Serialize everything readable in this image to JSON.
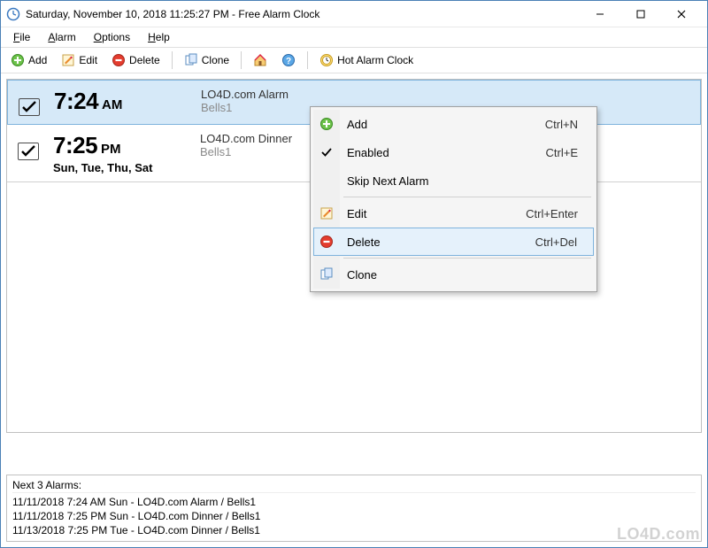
{
  "title": "Saturday, November 10, 2018 11:25:27 PM - Free Alarm Clock",
  "menu": {
    "file": "File",
    "alarm": "Alarm",
    "options": "Options",
    "help": "Help"
  },
  "toolbar": {
    "add": "Add",
    "edit": "Edit",
    "delete": "Delete",
    "clone": "Clone",
    "hot": "Hot Alarm Clock"
  },
  "alarms": [
    {
      "time": "7:24",
      "ampm": "AM",
      "days": "",
      "name": "LO4D.com Alarm",
      "sound": "Bells1",
      "checked": true,
      "selected": true
    },
    {
      "time": "7:25",
      "ampm": "PM",
      "days": "Sun, Tue, Thu, Sat",
      "name": "LO4D.com Dinner",
      "sound": "Bells1",
      "checked": true,
      "selected": false
    }
  ],
  "context_menu": {
    "add": {
      "label": "Add",
      "shortcut": "Ctrl+N"
    },
    "enabled": {
      "label": "Enabled",
      "shortcut": "Ctrl+E"
    },
    "skip": {
      "label": "Skip Next Alarm",
      "shortcut": ""
    },
    "edit": {
      "label": "Edit",
      "shortcut": "Ctrl+Enter"
    },
    "delete": {
      "label": "Delete",
      "shortcut": "Ctrl+Del"
    },
    "clone": {
      "label": "Clone",
      "shortcut": ""
    }
  },
  "next": {
    "title": "Next 3 Alarms:",
    "lines": [
      "11/11/2018 7:24 AM Sun - LO4D.com Alarm / Bells1",
      "11/11/2018 7:25 PM Sun - LO4D.com Dinner / Bells1",
      "11/13/2018 7:25 PM Tue - LO4D.com Dinner / Bells1"
    ]
  },
  "watermark": "LO4D.com"
}
